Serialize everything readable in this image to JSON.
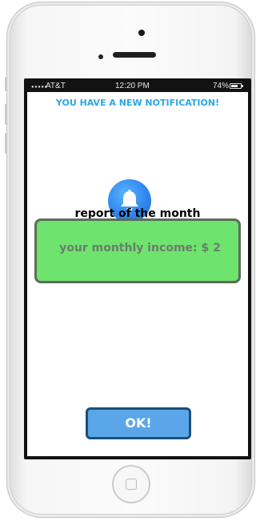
{
  "status_bar": {
    "signal": "●●●●●",
    "carrier": "AT&T",
    "time": "12:20 PM",
    "battery_percent": "74%",
    "battery_level": 0.74
  },
  "notification": {
    "header": "YOU HAVE A NEW NOTIFICATION!",
    "icon": "bell-icon",
    "icon_color": "#2f86ee",
    "report_title": "report of the month",
    "income_text": "your monthly income: $ 2",
    "income_bg_color": "#6ee36e",
    "ok_label": "OK!",
    "ok_color": "#5aa6e8"
  },
  "colors": {
    "header_text": "#29a8e6"
  }
}
